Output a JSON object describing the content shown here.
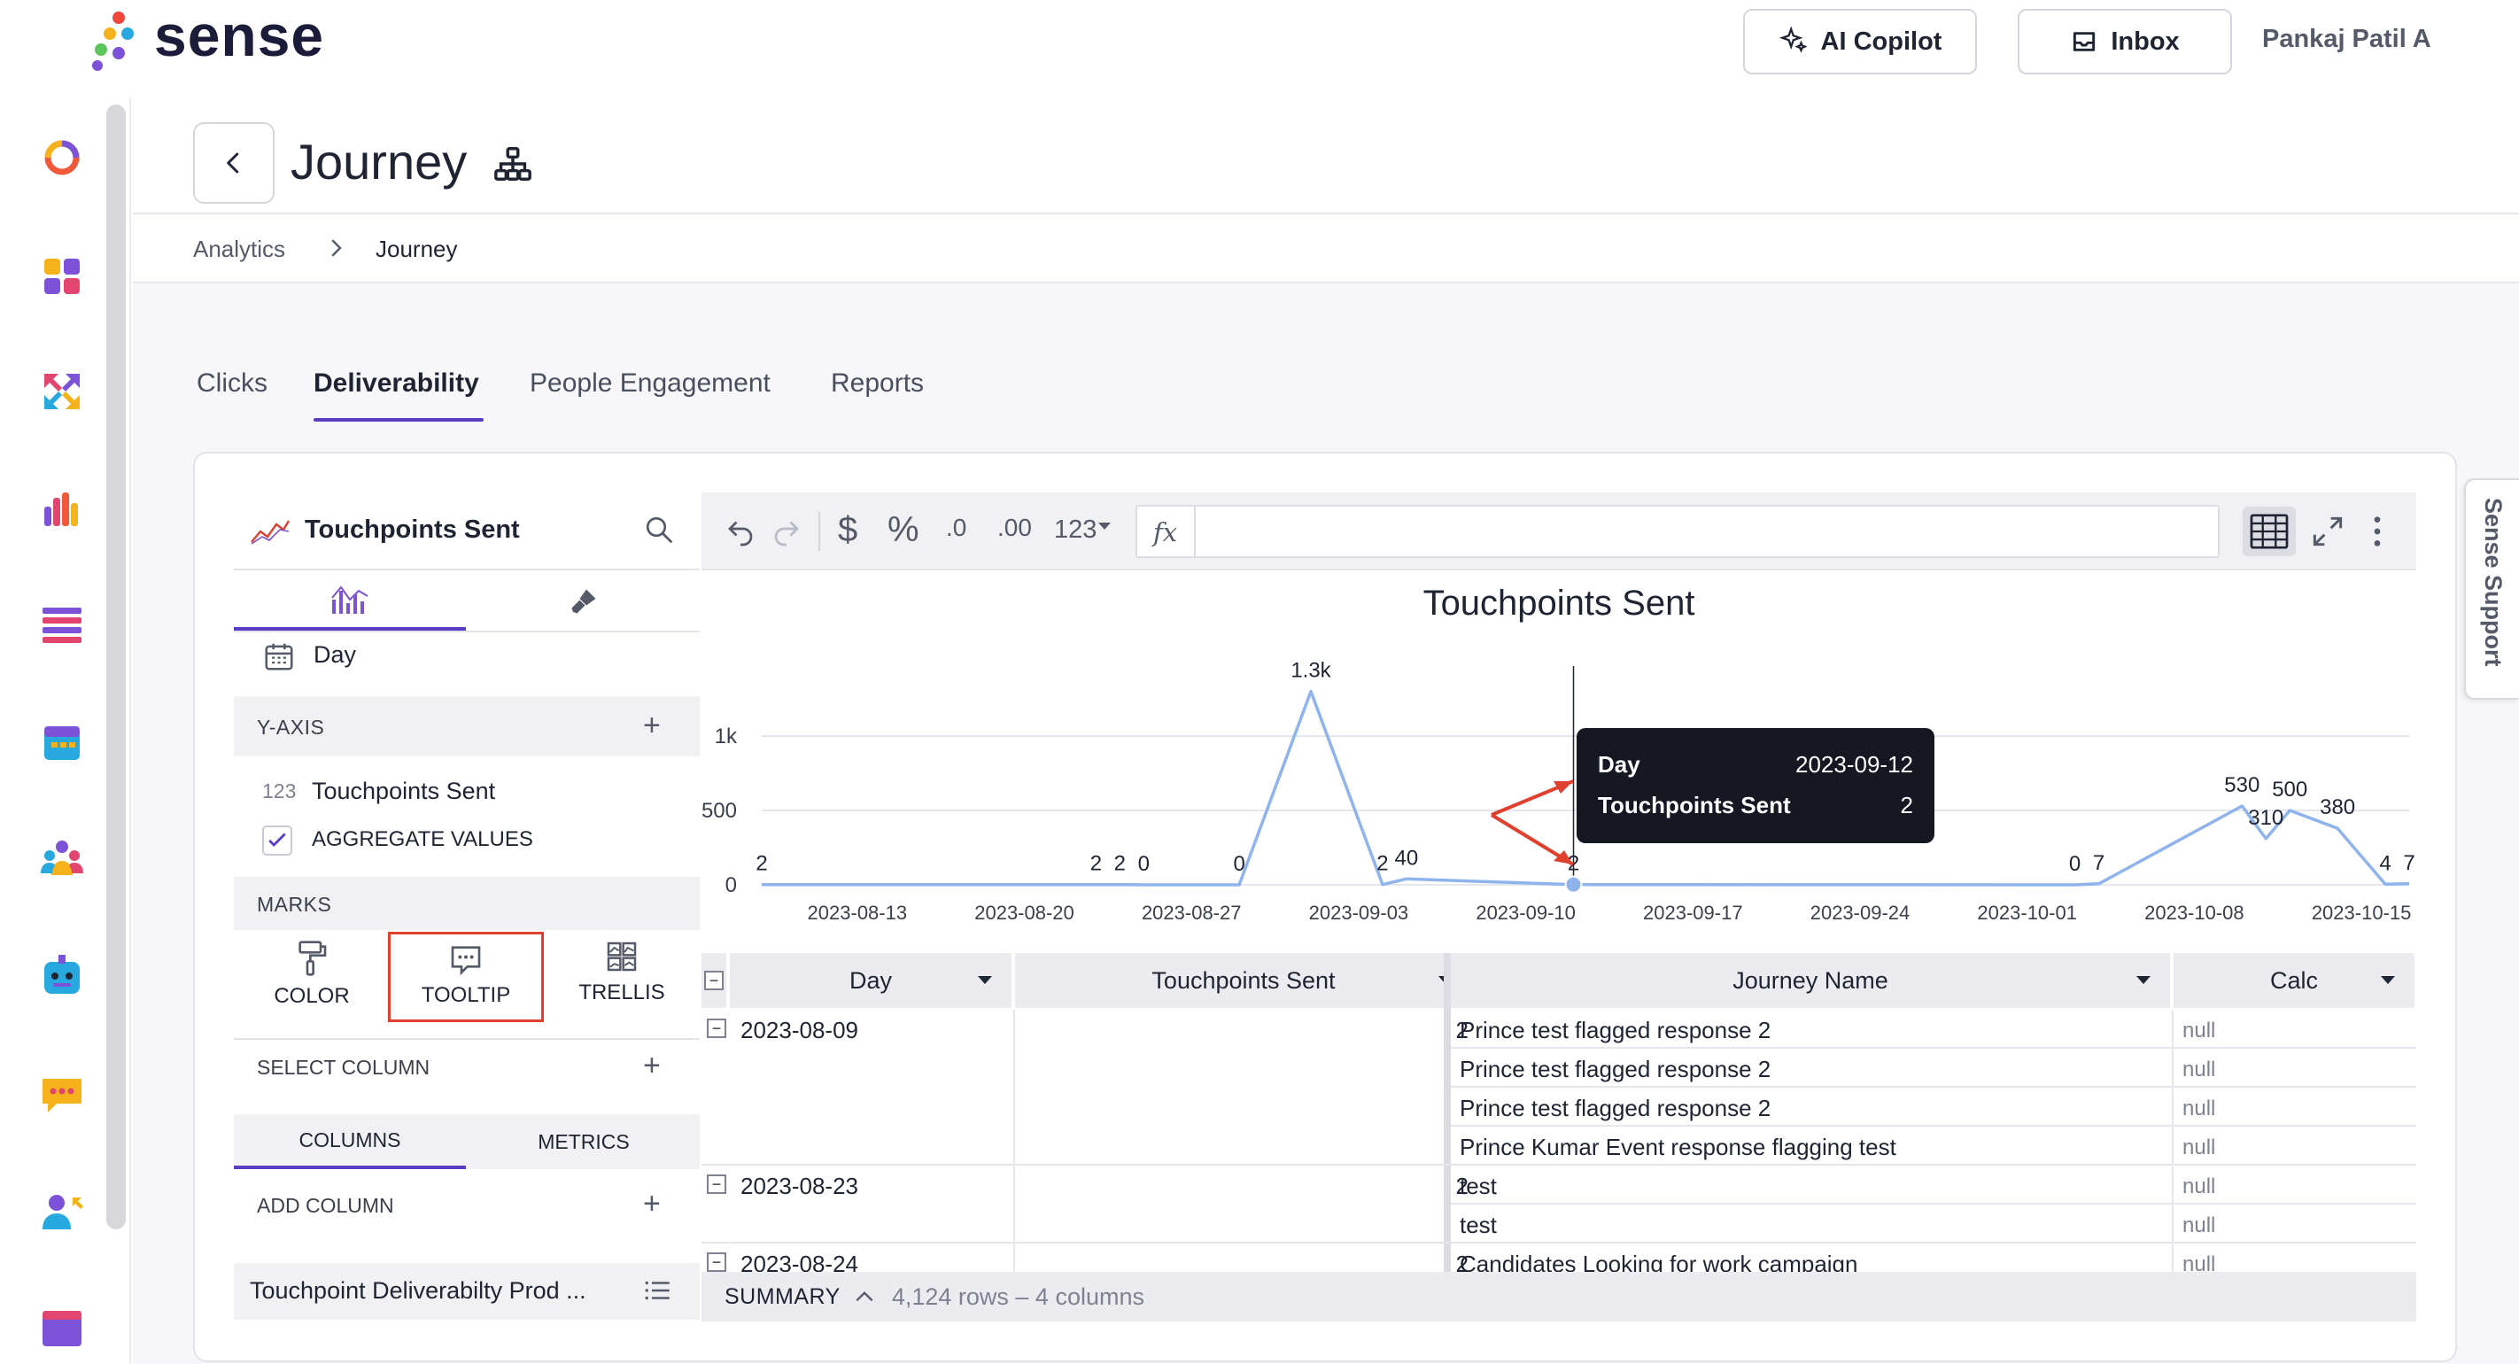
{
  "app": {
    "brand": "sense",
    "user": "Pankaj Patil A",
    "copilot_label": "AI Copilot",
    "inbox_label": "Inbox",
    "support_label": "Sense Support"
  },
  "page": {
    "title": "Journey",
    "breadcrumb": [
      "Analytics",
      "Journey"
    ]
  },
  "tabs": [
    {
      "label": "Clicks",
      "active": false
    },
    {
      "label": "Deliverability",
      "active": true
    },
    {
      "label": "People Engagement",
      "active": false
    },
    {
      "label": "Reports",
      "active": false
    }
  ],
  "left_panel": {
    "metric_title": "Touchpoints Sent",
    "x_axis_value": "Day",
    "y_axis_header": "Y-AXIS",
    "y_axis_type": "123",
    "y_axis_value": "Touchpoints Sent",
    "aggregate_label": "AGGREGATE VALUES",
    "aggregate_checked": true,
    "marks_header": "MARKS",
    "marks": [
      "COLOR",
      "TOOLTIP",
      "TRELLIS"
    ],
    "marks_selected": "TOOLTIP",
    "select_column": "SELECT COLUMN",
    "subtabs": [
      "COLUMNS",
      "METRICS"
    ],
    "add_column": "ADD COLUMN",
    "dataset_name": "Touchpoint Deliverabilty Prod ..."
  },
  "toolbar": {
    "currency": "$",
    "percent": "%",
    "dec_less": ".0",
    "dec_more": ".00",
    "format": "123",
    "fx": "fx"
  },
  "chart_data": {
    "type": "line",
    "title": "Touchpoints Sent",
    "xlabel": "",
    "ylabel": "",
    "ylim": [
      0,
      1300
    ],
    "y_ticks": [
      "0",
      "500",
      "1k"
    ],
    "x_ticks": [
      "2023-08-13",
      "2023-08-20",
      "2023-08-27",
      "2023-09-03",
      "2023-09-10",
      "2023-09-17",
      "2023-09-24",
      "2023-10-01",
      "2023-10-08",
      "2023-10-15"
    ],
    "x_range": [
      "2023-08-09",
      "2023-10-17"
    ],
    "points": [
      {
        "x": "2023-08-09",
        "y": 2,
        "label": "2"
      },
      {
        "x": "2023-08-23",
        "y": 2,
        "label": "2"
      },
      {
        "x": "2023-08-24",
        "y": 2,
        "label": "2"
      },
      {
        "x": "2023-08-25",
        "y": 0,
        "label": "0"
      },
      {
        "x": "2023-08-29",
        "y": 0,
        "label": "0"
      },
      {
        "x": "2023-09-01",
        "y": 1300,
        "label": "1.3k"
      },
      {
        "x": "2023-09-04",
        "y": 2,
        "label": "2"
      },
      {
        "x": "2023-09-05",
        "y": 40,
        "label": "40"
      },
      {
        "x": "2023-09-12",
        "y": 2,
        "label": "2"
      },
      {
        "x": "2023-10-03",
        "y": 0,
        "label": "0"
      },
      {
        "x": "2023-10-04",
        "y": 7,
        "label": "7"
      },
      {
        "x": "2023-10-10",
        "y": 530,
        "label": "530"
      },
      {
        "x": "2023-10-11",
        "y": 310,
        "label": "310"
      },
      {
        "x": "2023-10-12",
        "y": 500,
        "label": "500"
      },
      {
        "x": "2023-10-14",
        "y": 380,
        "label": "380"
      },
      {
        "x": "2023-10-16",
        "y": 4,
        "label": "4"
      },
      {
        "x": "2023-10-17",
        "y": 7,
        "label": "7"
      }
    ],
    "line_color": "#8fb3ec",
    "grid": true,
    "tooltip": {
      "label1": "Day",
      "value1": "2023-09-12",
      "label2": "Touchpoints Sent",
      "value2": "2"
    }
  },
  "table": {
    "columns": [
      "Day",
      "Touchpoints Sent",
      "Journey Name",
      "Calc"
    ],
    "groups": [
      {
        "day": "2023-08-09",
        "sent": "2",
        "rows": [
          {
            "name": "Prince test flagged response 2",
            "calc": "null"
          },
          {
            "name": "Prince test flagged response 2",
            "calc": "null"
          },
          {
            "name": "Prince test flagged response 2",
            "calc": "null"
          },
          {
            "name": "Prince Kumar Event response flagging test",
            "calc": "null"
          }
        ]
      },
      {
        "day": "2023-08-23",
        "sent": "2",
        "rows": [
          {
            "name": "test",
            "calc": "null"
          },
          {
            "name": "test",
            "calc": "null"
          }
        ]
      },
      {
        "day": "2023-08-24",
        "sent": "2",
        "rows": [
          {
            "name": "Candidates Looking for work campaign",
            "calc": "null"
          }
        ]
      }
    ]
  },
  "summary": {
    "label": "SUMMARY",
    "info": "4,124 rows – 4 columns"
  },
  "colors": {
    "accent": "#5b3cc4",
    "highlight_red": "#e0402e",
    "tooltip_bg": "#151722"
  }
}
